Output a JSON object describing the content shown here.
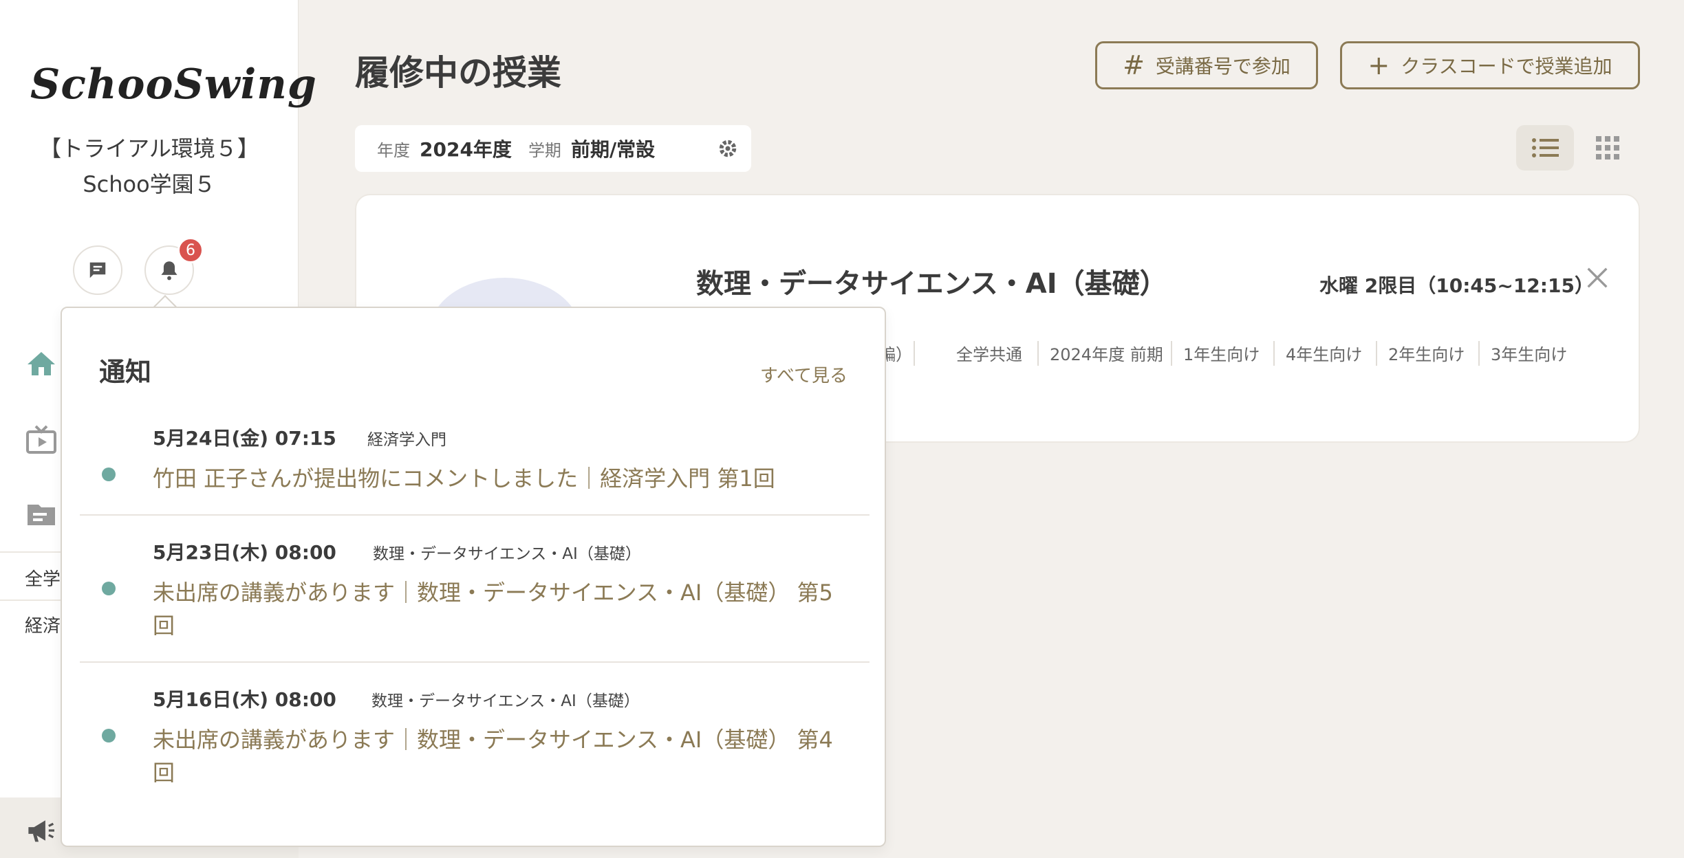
{
  "sidebar": {
    "logo_text": "SchooSwing",
    "org_name": "【トライアル環境５】Schoo学園５",
    "notification_count": "6",
    "categories": [
      "全学",
      "経済"
    ]
  },
  "main": {
    "title": "履修中の授業",
    "join_button": "受講番号で参加",
    "add_button": "クラスコードで授業追加",
    "filter": {
      "year_label": "年度",
      "year_value": "2024年度",
      "term_label": "学期",
      "term_value": "前期/常設"
    }
  },
  "course": {
    "title": "数理・データサイエンス・AI（基礎）",
    "time": "水曜 2限目（10:45~12:15）",
    "tags": [
      "編）",
      "全学共通",
      "2024年度 前期",
      "1年生向け",
      "4年生向け",
      "2年生向け",
      "3年生向け"
    ]
  },
  "notifications": {
    "title": "通知",
    "see_all": "すべて見る",
    "items": [
      {
        "date": "5月24日(金) 07:15",
        "course": "経済学入門",
        "message": "竹田 正子さんが提出物にコメントしました｜経済学入門 第1回"
      },
      {
        "date": "5月23日(木) 08:00",
        "course": "数理・データサイエンス・AI（基礎）",
        "message": "未出席の講義があります｜数理・データサイエンス・AI（基礎） 第5回"
      },
      {
        "date": "5月16日(木) 08:00",
        "course": "数理・データサイエンス・AI（基礎）",
        "message": "未出席の講義があります｜数理・データサイエンス・AI（基礎） 第4回"
      }
    ]
  },
  "colors": {
    "accent": "#8b7a55",
    "dot": "#6fa9a0",
    "badge": "#d9534f",
    "background": "#f3f0ec"
  }
}
